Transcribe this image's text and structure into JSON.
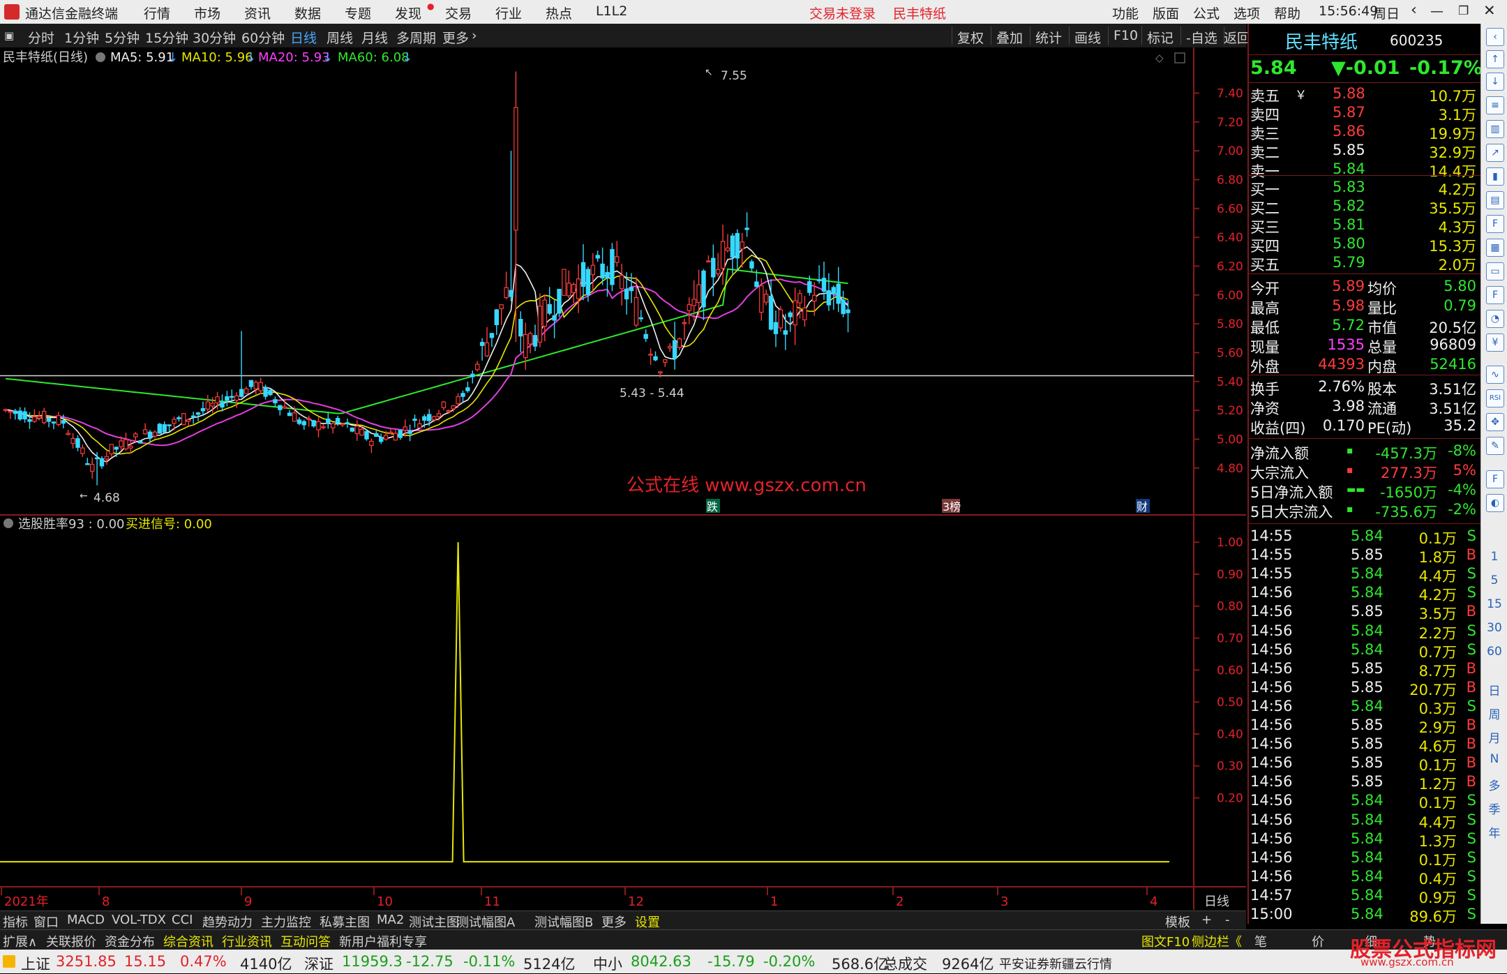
{
  "app": {
    "title": "通达信金融终端",
    "menu": [
      "行情",
      "市场",
      "资讯",
      "数据",
      "专题",
      "发现",
      "交易",
      "行业",
      "热点",
      "L1L2"
    ],
    "status_red": [
      "交易未登录",
      "民丰特纸"
    ],
    "right_menu": [
      "功能",
      "版面",
      "公式",
      "选项",
      "帮助"
    ],
    "time": "15:56:49",
    "weekday": "周日"
  },
  "periodbar": {
    "periods": [
      "分时",
      "1分钟",
      "5分钟",
      "15分钟",
      "30分钟",
      "60分钟",
      "日线",
      "周线",
      "月线",
      "多周期",
      "更多"
    ],
    "active": "日线",
    "tools": [
      "复权",
      "叠加",
      "统计",
      "画线",
      "F10",
      "标记",
      "-自选",
      "返回"
    ]
  },
  "mainchart": {
    "header_name": "民丰特纸(日线)",
    "ma": [
      {
        "label": "MA5: 5.91",
        "color": "#f0f0f0"
      },
      {
        "label": "MA10: 5.96",
        "color": "#e8e800"
      },
      {
        "label": "MA20: 5.93",
        "color": "#ff40ff"
      },
      {
        "label": "MA60: 6.08",
        "color": "#2ee82e"
      }
    ],
    "annotations": {
      "high": "7.55",
      "low": "4.68",
      "range": "5.43 - 5.44"
    },
    "watermark": "公式在线  www.gszx.com.cn",
    "events": [
      "跌",
      "3榜",
      "财"
    ]
  },
  "subchart": {
    "header": "选股胜率93 : 0.00",
    "signal": "买进信号: 0.00"
  },
  "x_axis": {
    "labels": [
      "2021年",
      "8",
      "9",
      "10",
      "11",
      "12",
      "1",
      "2",
      "3",
      "4"
    ],
    "period_label": "日线"
  },
  "chart_data": [
    {
      "type": "candlestick",
      "title": "民丰特纸(日线)",
      "y_ticks": [
        "7.40",
        "7.20",
        "7.00",
        "6.80",
        "6.60",
        "6.40",
        "6.20",
        "6.00",
        "5.80",
        "5.60",
        "5.40",
        "5.20",
        "5.00",
        "4.80"
      ],
      "ylim": [
        4.62,
        7.62
      ],
      "annotations": {
        "high": 7.55,
        "low": 4.68,
        "reference_line": 5.44
      },
      "ma_values": {
        "MA5": 5.91,
        "MA10": 5.96,
        "MA20": 5.93,
        "MA60": 6.08
      }
    },
    {
      "type": "line",
      "title": "选股胜率93",
      "y_ticks": [
        "1.00",
        "0.90",
        "0.80",
        "0.70",
        "0.60",
        "0.50",
        "0.40",
        "0.30",
        "0.20"
      ],
      "ylim": [
        -0.05,
        1.02
      ],
      "series": [
        {
          "name": "选股胜率93",
          "spike_value": 1.0,
          "base_value": 0.0
        }
      ]
    }
  ],
  "quote": {
    "name": "民丰特纸",
    "code": "600235",
    "price": "5.84",
    "change": "▼-0.01",
    "change_pct": "-0.17%",
    "asks": [
      {
        "label": "卖五",
        "price": "5.88",
        "vol": "10.7万",
        "pc": "rr"
      },
      {
        "label": "卖四",
        "price": "5.87",
        "vol": "3.1万",
        "pc": "rr"
      },
      {
        "label": "卖三",
        "price": "5.86",
        "vol": "19.9万",
        "pc": "rr"
      },
      {
        "label": "卖二",
        "price": "5.85",
        "vol": "32.9万",
        "pc": "w"
      },
      {
        "label": "卖一",
        "price": "5.84",
        "vol": "14.4万",
        "pc": "g"
      }
    ],
    "bids": [
      {
        "label": "买一",
        "price": "5.83",
        "vol": "4.2万",
        "pc": "g"
      },
      {
        "label": "买二",
        "price": "5.82",
        "vol": "35.5万",
        "pc": "g"
      },
      {
        "label": "买三",
        "price": "5.81",
        "vol": "4.3万",
        "pc": "g"
      },
      {
        "label": "买四",
        "price": "5.80",
        "vol": "15.3万",
        "pc": "g"
      },
      {
        "label": "买五",
        "price": "5.79",
        "vol": "2.0万",
        "pc": "g"
      }
    ],
    "stats": [
      {
        "l1": "今开",
        "v1": "5.89",
        "c1": "rr",
        "l2": "均价",
        "v2": "5.80",
        "c2": "g"
      },
      {
        "l1": "最高",
        "v1": "5.98",
        "c1": "rr",
        "l2": "量比",
        "v2": "0.79",
        "c2": "g"
      },
      {
        "l1": "最低",
        "v1": "5.72",
        "c1": "g",
        "l2": "市值",
        "v2": "20.5亿",
        "c2": "w"
      },
      {
        "l1": "现量",
        "v1": "1535",
        "c1": "m",
        "l2": "总量",
        "v2": "96809",
        "c2": "w"
      },
      {
        "l1": "外盘",
        "v1": "44393",
        "c1": "rr",
        "l2": "内盘",
        "v2": "52416",
        "c2": "g"
      }
    ],
    "stats2": [
      {
        "l1": "换手",
        "v1": "2.76%",
        "l2": "股本",
        "v2": "3.51亿"
      },
      {
        "l1": "净资",
        "v1": "3.98",
        "l2": "流通",
        "v2": "3.51亿"
      },
      {
        "l1": "收益(四)",
        "v1": "0.170",
        "l2": "PE(动)",
        "v2": "35.2"
      }
    ],
    "flows": [
      {
        "label": "净流入额",
        "val": "-457.3万",
        "pct": "-8%",
        "vc": "g",
        "pcc": "g"
      },
      {
        "label": "大宗流入",
        "val": "277.3万",
        "pct": "5%",
        "vc": "rr",
        "pcc": "rr"
      },
      {
        "label": "5日净流入额",
        "val": "-1650万",
        "pct": "-4%",
        "vc": "g",
        "pcc": "g"
      },
      {
        "label": "5日大宗流入",
        "val": "-735.6万",
        "pct": "-2%",
        "vc": "g",
        "pcc": "g"
      }
    ],
    "ticks": [
      {
        "t": "14:55",
        "p": "5.84",
        "v": "0.1万",
        "s": "S"
      },
      {
        "t": "14:55",
        "p": "5.85",
        "v": "1.8万",
        "s": "B"
      },
      {
        "t": "14:55",
        "p": "5.84",
        "v": "4.4万",
        "s": "S"
      },
      {
        "t": "14:56",
        "p": "5.84",
        "v": "4.2万",
        "s": "S"
      },
      {
        "t": "14:56",
        "p": "5.85",
        "v": "3.5万",
        "s": "B"
      },
      {
        "t": "14:56",
        "p": "5.84",
        "v": "2.2万",
        "s": "S"
      },
      {
        "t": "14:56",
        "p": "5.84",
        "v": "0.7万",
        "s": "S"
      },
      {
        "t": "14:56",
        "p": "5.85",
        "v": "8.7万",
        "s": "B"
      },
      {
        "t": "14:56",
        "p": "5.85",
        "v": "20.7万",
        "s": "B"
      },
      {
        "t": "14:56",
        "p": "5.84",
        "v": "0.3万",
        "s": "S"
      },
      {
        "t": "14:56",
        "p": "5.85",
        "v": "2.9万",
        "s": "B"
      },
      {
        "t": "14:56",
        "p": "5.85",
        "v": "4.6万",
        "s": "B"
      },
      {
        "t": "14:56",
        "p": "5.85",
        "v": "0.1万",
        "s": "B"
      },
      {
        "t": "14:56",
        "p": "5.85",
        "v": "1.2万",
        "s": "B"
      },
      {
        "t": "14:56",
        "p": "5.84",
        "v": "0.1万",
        "s": "S"
      },
      {
        "t": "14:56",
        "p": "5.84",
        "v": "4.4万",
        "s": "S"
      },
      {
        "t": "14:56",
        "p": "5.84",
        "v": "1.3万",
        "s": "S"
      },
      {
        "t": "14:56",
        "p": "5.84",
        "v": "0.1万",
        "s": "S"
      },
      {
        "t": "14:56",
        "p": "5.84",
        "v": "0.4万",
        "s": "S"
      },
      {
        "t": "14:57",
        "p": "5.84",
        "v": "0.9万",
        "s": "S"
      },
      {
        "t": "15:00",
        "p": "5.84",
        "v": "89.6万",
        "s": "S"
      }
    ],
    "bottom_tabs": [
      "笔",
      "价",
      "细",
      "势"
    ]
  },
  "sidebar_icons": [
    "1",
    "5",
    "15",
    "30",
    "60",
    "日",
    "周",
    "月",
    "N",
    "多",
    "季",
    "年"
  ],
  "tabs": {
    "row1": [
      "指标",
      "窗口",
      "MACD",
      "VOL-TDX",
      "CCI",
      "趋势动力",
      "主力监控",
      "私募主图",
      "MA2",
      "测试主图",
      "测试幅图A",
      "测试幅图B",
      "更多",
      "设置"
    ],
    "row1_active": "设置",
    "row1_right": [
      "模板",
      "+",
      "-"
    ],
    "row2": [
      "扩展∧",
      "关联报价",
      "资金分布",
      "综合资讯",
      "行业资讯",
      "互动问答",
      "新用户福利专享"
    ],
    "row2_right": [
      "图文F10",
      "侧边栏《"
    ]
  },
  "statusbar": {
    "items": [
      {
        "name": "上证",
        "val": "3251.85",
        "chg": "15.15",
        "pct": "0.47%",
        "amt": "4140亿",
        "color": "rr"
      },
      {
        "name": "深证",
        "val": "11959.3",
        "chg": "-12.75",
        "pct": "-0.11%",
        "amt": "5124亿",
        "color": "g"
      },
      {
        "name": "中小",
        "val": "8042.63",
        "chg": "-15.79",
        "pct": "-0.20%",
        "amt": "568.6亿",
        "color": "g"
      }
    ],
    "total_label": "总成交",
    "total_val": "9264亿",
    "broker": "平安证券新疆云行情"
  },
  "watermark": {
    "big": "股票公式指标网",
    "small": "www.gszx.com.cn"
  }
}
